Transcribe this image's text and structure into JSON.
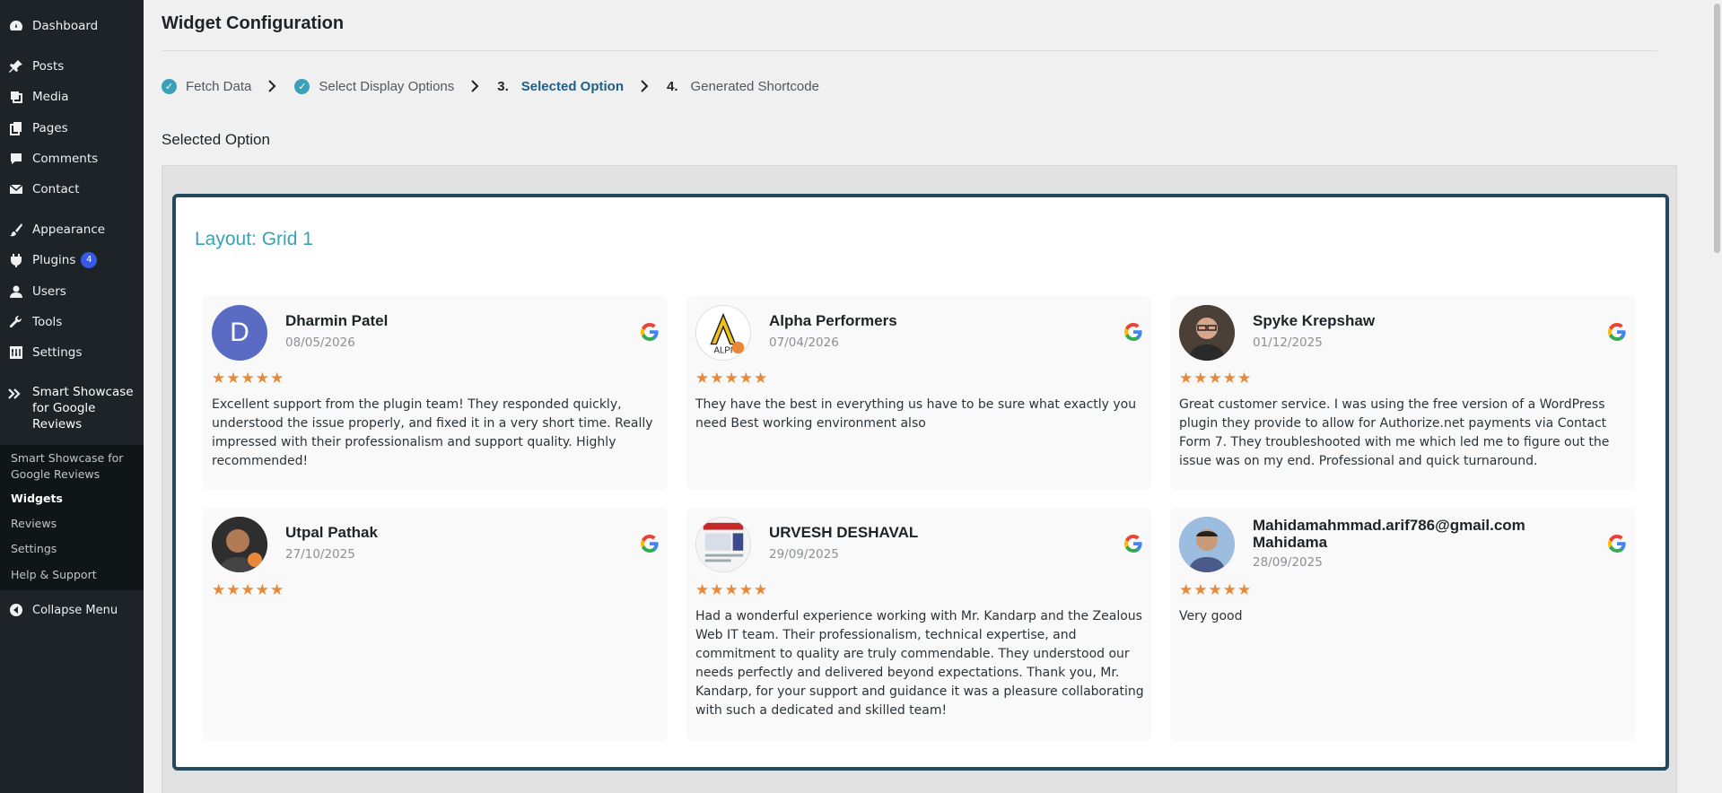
{
  "sidebar": {
    "items": [
      {
        "label": "Dashboard",
        "icon": "dashboard-icon"
      },
      {
        "label": "Posts",
        "icon": "pin-icon"
      },
      {
        "label": "Media",
        "icon": "media-icon"
      },
      {
        "label": "Pages",
        "icon": "pages-icon"
      },
      {
        "label": "Comments",
        "icon": "comment-icon"
      },
      {
        "label": "Contact",
        "icon": "mail-icon"
      },
      {
        "label": "Appearance",
        "icon": "brush-icon"
      },
      {
        "label": "Plugins",
        "icon": "plugin-icon",
        "badge": "4"
      },
      {
        "label": "Users",
        "icon": "user-icon"
      },
      {
        "label": "Tools",
        "icon": "wrench-icon"
      },
      {
        "label": "Settings",
        "icon": "settings-icon"
      }
    ],
    "current": {
      "label": "Smart Showcase for Google Reviews",
      "icon": "plugin-logo-icon"
    },
    "submenu": [
      {
        "label": "Smart Showcase for Google Reviews",
        "active": false
      },
      {
        "label": "Widgets",
        "active": true
      },
      {
        "label": "Reviews",
        "active": false
      },
      {
        "label": "Settings",
        "active": false
      },
      {
        "label": "Help & Support",
        "active": false
      }
    ],
    "collapse_label": "Collapse Menu"
  },
  "page": {
    "title": "Widget Configuration",
    "section_title": "Selected Option"
  },
  "steps": [
    {
      "num": "",
      "label": "Fetch Data",
      "state": "done"
    },
    {
      "num": "",
      "label": "Select Display Options",
      "state": "done"
    },
    {
      "num": "3.",
      "label": "Selected Option",
      "state": "active"
    },
    {
      "num": "4.",
      "label": "Generated Shortcode",
      "state": "pending"
    }
  ],
  "preview": {
    "layout_title": "Layout: Grid 1",
    "rating_stars": "★★★★★",
    "reviews": [
      {
        "name": "Dharmin Patel",
        "date": "08/05/2026",
        "rating": 5,
        "avatar": "D",
        "text": "Excellent support from the plugin team! They responded quickly, understood the issue properly, and fixed it in a very short time. Really impressed with their professionalism and support quality. Highly recommended!"
      },
      {
        "name": "Alpha Performers",
        "date": "07/04/2026",
        "rating": 5,
        "avatar": "",
        "text": "They have the best in everything us have to be sure what exactly you need Best working environment also"
      },
      {
        "name": "Spyke Krepshaw",
        "date": "01/12/2025",
        "rating": 5,
        "avatar": "",
        "text": "Great customer service. I was using the free version of a WordPress plugin they provide to allow for Authorize.net payments via Contact Form 7. They troubleshooted with me which led me to figure out the issue was on my end. Professional and quick turnaround."
      },
      {
        "name": "Utpal Pathak",
        "date": "27/10/2025",
        "rating": 5,
        "avatar": "",
        "text": ""
      },
      {
        "name": "URVESH DESHAVAL",
        "date": "29/09/2025",
        "rating": 5,
        "avatar": "",
        "text": "Had a wonderful experience working with Mr. Kandarp and the Zealous Web IT team. Their professionalism, technical expertise, and commitment to quality are truly commendable. They understood our needs perfectly and delivered beyond expectations. Thank you, Mr. Kandarp, for your support and guidance it was a pleasure collaborating with such a dedicated and skilled team!"
      },
      {
        "name": "Mahidamahmmad.arif786@gmail.com Mahidama",
        "date": "28/09/2025",
        "rating": 5,
        "avatar": "",
        "text": "Very good"
      }
    ]
  },
  "colors": {
    "accent": "#3aa1b6",
    "card_border": "#23485f",
    "star": "#e8893a",
    "sidebar_bg": "#1d2327"
  }
}
